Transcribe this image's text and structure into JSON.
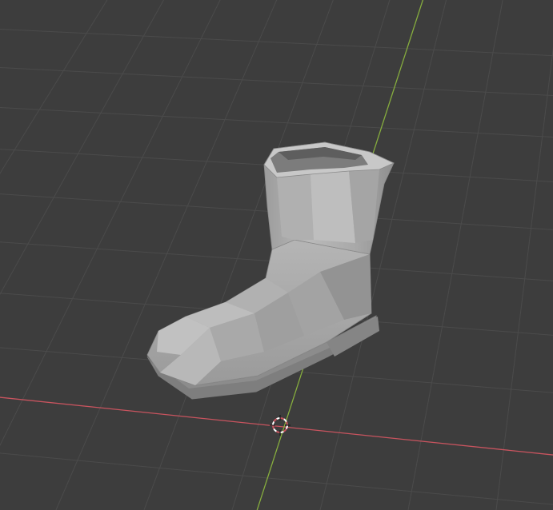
{
  "viewport": {
    "background": "#3d3d3d",
    "grid_color": "#4d4d4d",
    "x_axis_color": "#c9545f",
    "y_axis_color": "#86ad3e",
    "object": "boot-mesh",
    "cursor_icon": "3d-cursor-icon"
  }
}
